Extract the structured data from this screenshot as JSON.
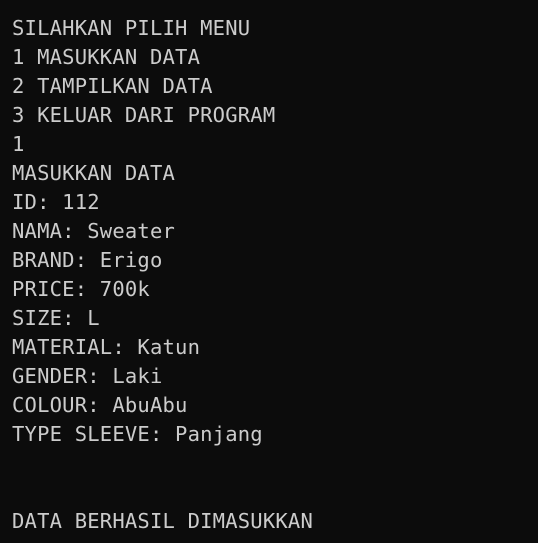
{
  "terminal": {
    "lines": [
      "SILAHKAN PILIH MENU",
      "1 MASUKKAN DATA",
      "2 TAMPILKAN DATA",
      "3 KELUAR DARI PROGRAM",
      "1",
      "MASUKKAN DATA",
      "ID: 112",
      "NAMA: Sweater",
      "BRAND: Erigo",
      "PRICE: 700k",
      "SIZE: L",
      "MATERIAL: Katun",
      "GENDER: Laki",
      "COLOUR: AbuAbu",
      "TYPE SLEEVE: Panjang",
      "",
      "",
      "DATA BERHASIL DIMASUKKAN"
    ],
    "colors": {
      "background": "#0c0c0c",
      "text": "#cccccc"
    }
  }
}
